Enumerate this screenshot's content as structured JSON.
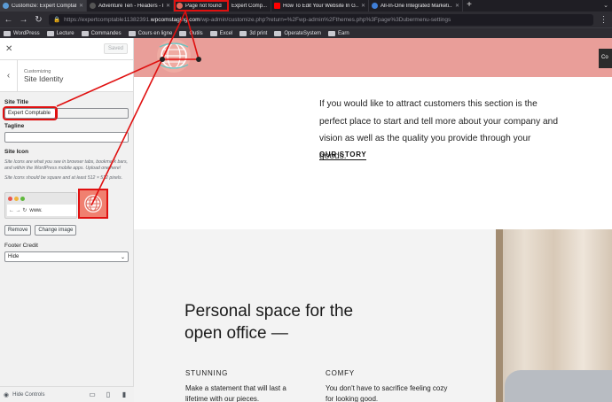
{
  "browser": {
    "tabs": [
      {
        "label": "Customize: Expert Comptable",
        "fav": "#5b9bd5",
        "active": true
      },
      {
        "label": "Adventure Ten - Headers - Pro",
        "fav": "#2d2c32"
      },
      {
        "label": "Page not found",
        "fav": "#e06b5e",
        "highlight": true
      },
      {
        "label": "Expert Comp...",
        "fav": "#e06b5e"
      },
      {
        "label": "How To Edit Your Website In G...",
        "fav": "#ff0000"
      },
      {
        "label": "All-In-One Integrated Marketi...",
        "fav": "#3f7fd8"
      }
    ],
    "url_prefix": "https://expertcomptable11382391.",
    "url_domain": "wpcomstaging.com",
    "url_suffix": "/wp-admin/customize.php?return=%2Fwp-admin%2Fthemes.php%3Fpage%3Dubermenu-settings",
    "bookmarks": [
      "WordPress",
      "Lecture",
      "Commandes",
      "Cours en ligne",
      "Outils",
      "Excel",
      "3d print",
      "OperateSystem",
      "Earn"
    ]
  },
  "sidebar": {
    "saved_label": "Saved",
    "subtitle": "Customizing",
    "title": "Site Identity",
    "site_title_label": "Site Title",
    "site_title_value": "Expert Comptable",
    "tagline_label": "Tagline",
    "tagline_value": "",
    "site_icon_label": "Site Icon",
    "site_icon_desc": "Site Icons are what you see in browser tabs, bookmark bars, and within the WordPress mobile apps. Upload one here!",
    "site_icon_size": "Site Icons should be square and at least 512 × 512 pixels.",
    "mini_url": "www.",
    "remove_label": "Remove",
    "change_label": "Change image",
    "footer_credit_label": "Footer Credit",
    "footer_credit_value": "Hide",
    "hide_controls_label": "Hide Controls"
  },
  "preview": {
    "contact_label": "Co",
    "story_text": "If you would like to attract customers this section is the perfect place to start and tell more about your company and vision as well as the quality you provide through your goods.",
    "story_link": "OUR STORY",
    "feature_title": "Personal space for the open office —",
    "feature_1_heading": "STUNNING",
    "feature_1_text": "Make a statement that will last a lifetime with our pieces.",
    "feature_2_heading": "COMFY",
    "feature_2_text": "You don't have to sacrifice feeling cozy for looking good."
  },
  "colors": {
    "accent_band": "#e99e99",
    "annotation": "#e01010"
  }
}
